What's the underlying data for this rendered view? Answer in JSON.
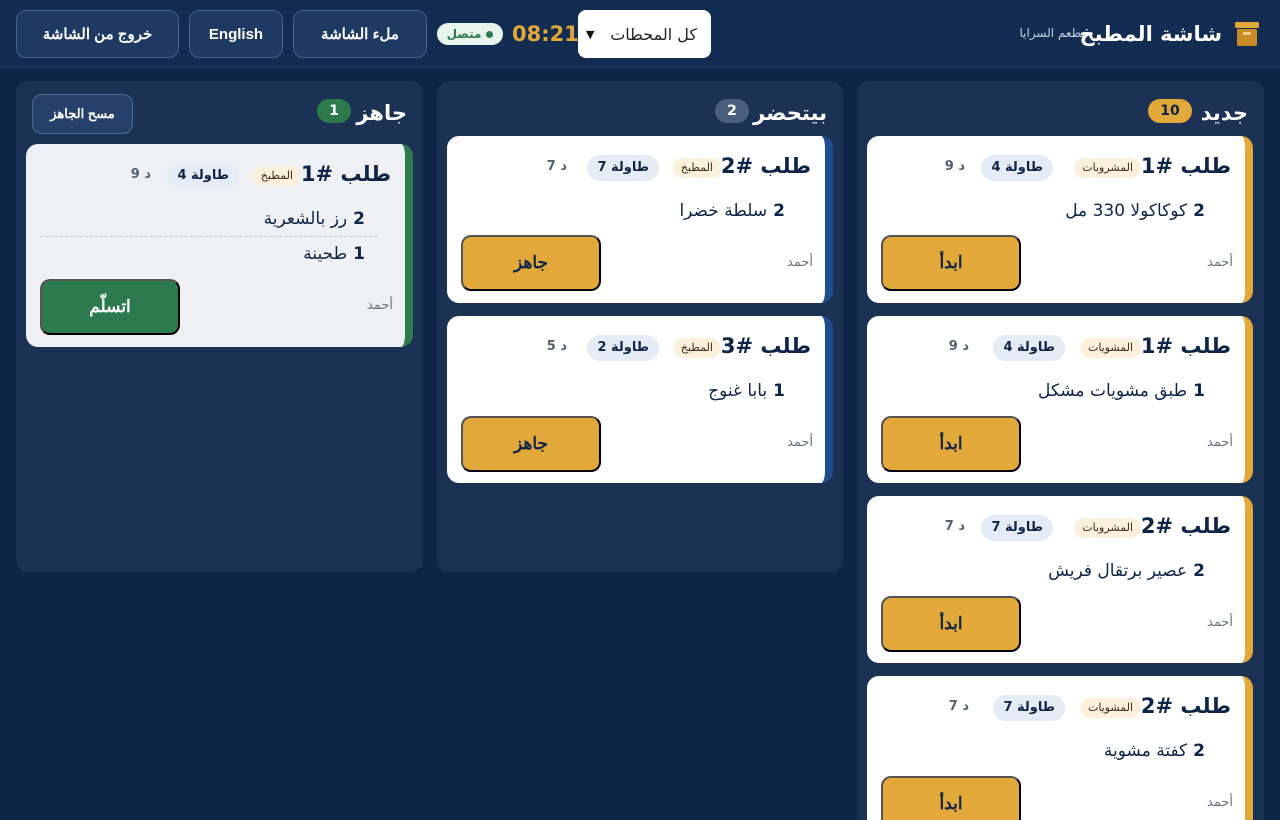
{
  "header": {
    "brand_title": "شاشة المطبخ",
    "brand_subtitle": "مطعم السرايا",
    "station_select_value": "كل المحطات",
    "clock": "08:21",
    "connection_status": "متصل",
    "buttons": {
      "fullscreen": "ملء الشاشة",
      "language": "English",
      "exit": "خروج من الشاشة"
    }
  },
  "columns": {
    "new": {
      "title": "جديد",
      "count": "10",
      "cards": [
        {
          "title": "طلب #1",
          "station": "المشروبات",
          "table": "طاولة 4",
          "age": "9 د",
          "items": [
            {
              "qty": "2",
              "name": "كوكاكولا 330 مل"
            }
          ],
          "staff": "أحمد",
          "action": "ابدأ"
        },
        {
          "title": "طلب #1",
          "station": "المشويات",
          "table": "طاولة 4",
          "age": "9 د",
          "items": [
            {
              "qty": "1",
              "name": "طبق مشويات مشكل"
            }
          ],
          "staff": "أحمد",
          "action": "ابدأ"
        },
        {
          "title": "طلب #2",
          "station": "المشروبات",
          "table": "طاولة 7",
          "age": "7 د",
          "items": [
            {
              "qty": "2",
              "name": "عصير برتقال فريش"
            }
          ],
          "staff": "أحمد",
          "action": "ابدأ"
        },
        {
          "title": "طلب #2",
          "station": "المشويات",
          "table": "طاولة 7",
          "age": "7 د",
          "items": [
            {
              "qty": "2",
              "name": "كفتة مشوية"
            }
          ],
          "staff": "أحمد",
          "action": "ابدأ"
        }
      ]
    },
    "preparing": {
      "title": "بيتحضر",
      "count": "2",
      "cards": [
        {
          "title": "طلب #2",
          "station": "المطبخ",
          "table": "طاولة 7",
          "age": "7 د",
          "items": [
            {
              "qty": "2",
              "name": "سلطة خضرا"
            }
          ],
          "staff": "أحمد",
          "action": "جاهز"
        },
        {
          "title": "طلب #3",
          "station": "المطبخ",
          "table": "طاولة 2",
          "age": "5 د",
          "items": [
            {
              "qty": "1",
              "name": "بابا غنوج"
            }
          ],
          "staff": "أحمد",
          "action": "جاهز"
        }
      ]
    },
    "ready": {
      "title": "جاهز",
      "count": "1",
      "clear_label": "مسح الجاهز",
      "cards": [
        {
          "title": "طلب #1",
          "station": "المطبخ",
          "table": "طاولة 4",
          "age": "9 د",
          "items": [
            {
              "qty": "2",
              "name": "رز بالشعرية"
            },
            {
              "qty": "1",
              "name": "طحينة"
            }
          ],
          "staff": "أحمد",
          "action": "اتسلّم"
        }
      ]
    }
  },
  "colors": {
    "background": "#0f2547",
    "accent_gold": "#e3a83a",
    "prep_blue": "#1f4d8f",
    "ready_green": "#2c7a4d"
  },
  "icons": {
    "brand": "kitchen-box-icon"
  }
}
